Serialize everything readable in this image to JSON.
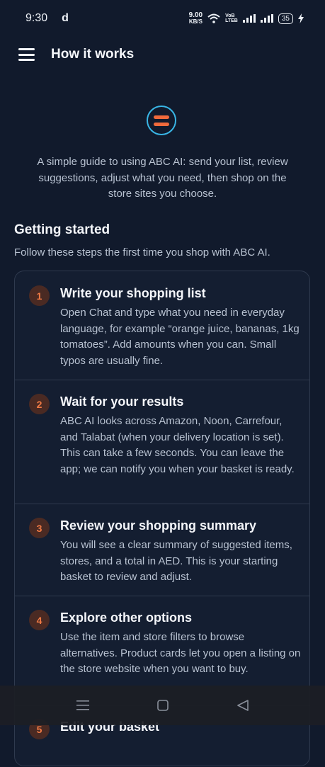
{
  "status_bar": {
    "time": "9:30",
    "carrier": "d",
    "net_speed_value": "9.00",
    "net_speed_unit": "KB/S",
    "volte_top": "VoB",
    "volte_bottom": "LTEB",
    "battery": "35"
  },
  "app_bar": {
    "title": "How it works"
  },
  "intro_text": "A simple guide to using ABC AI: send your list, review suggestions, adjust what you need, then shop on the store sites you choose.",
  "getting_started": {
    "title": "Getting started",
    "subtitle": "Follow these steps the first time you shop with ABC AI."
  },
  "steps": [
    {
      "number": "1",
      "title": "Write your shopping list",
      "body": "Open Chat and type what you need in everyday language, for example “orange juice, bananas, 1kg tomatoes”. Add amounts when you can. Small typos are usually fine."
    },
    {
      "number": "2",
      "title": "Wait for your results",
      "body": "ABC AI looks across Amazon, Noon, Carrefour, and Talabat (when your delivery location is set). This can take a few seconds. You can leave the app; we can notify you when your basket is ready."
    },
    {
      "number": "3",
      "title": "Review your shopping summary",
      "body": "You will see a clear summary of suggested items, stores, and a total in AED. This is your starting basket to review and adjust."
    },
    {
      "number": "4",
      "title": "Explore other options",
      "body": "Use the item and store filters to browse alternatives. Product cards let you open a listing on the store website when you want to buy."
    },
    {
      "number": "5",
      "title": "Edit your basket",
      "body": ""
    }
  ],
  "colors": {
    "background": "#111a2c",
    "accent_orange": "#f06a3c",
    "accent_blue": "#39b6e6"
  }
}
